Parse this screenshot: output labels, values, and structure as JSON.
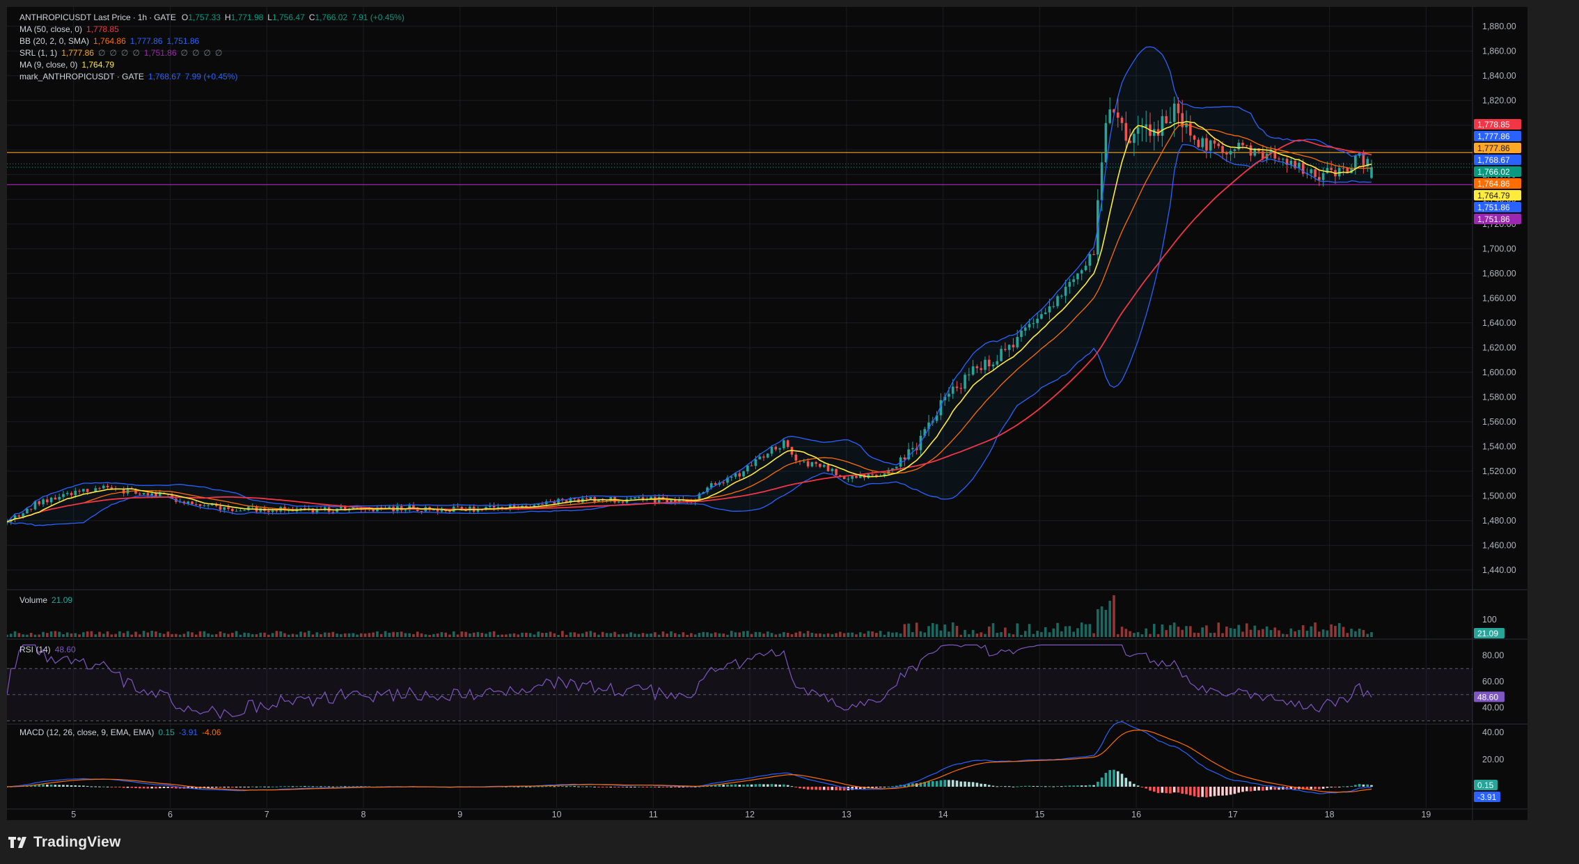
{
  "header": {
    "symbol": "ANTHROPICUSDT",
    "price_type": "Last Price",
    "interval": "1h",
    "exchange": "GATE",
    "sep": "·",
    "o_label": "O",
    "o_value": "1,757.33",
    "h_label": "H",
    "h_value": "1,771.98",
    "l_label": "L",
    "l_value": "1,756.47",
    "c_label": "C",
    "c_value": "1,766.02",
    "change": "7.91 (+0.45%)"
  },
  "indicators": [
    {
      "label": "MA (50, close, 0)",
      "values": [
        "1,778.85"
      ],
      "colors": [
        "#f23645"
      ]
    },
    {
      "label": "BB (20, 2, 0, SMA)",
      "values": [
        "1,764.86",
        "1,777.86",
        "1,751.86"
      ],
      "colors": [
        "#ff6d00",
        "#2962ff",
        "#2962ff"
      ]
    },
    {
      "label": "SRL (1, 1)",
      "values": [
        "1,777.86",
        "∅",
        "∅",
        "∅",
        "∅",
        "1,751.86",
        "∅",
        "∅",
        "∅",
        "∅"
      ],
      "colors": [
        "#ffa726",
        "#787b86",
        "#787b86",
        "#787b86",
        "#787b86",
        "#9c27b0",
        "#787b86",
        "#787b86",
        "#787b86",
        "#787b86"
      ]
    },
    {
      "label": "MA (9, close, 0)",
      "values": [
        "1,764.79"
      ],
      "colors": [
        "#ffeb3b"
      ]
    },
    {
      "label": "mark_ANTHROPICUSDT · GATE",
      "values": [
        "1,768.67",
        "7.99 (+0.45%)"
      ],
      "colors": [
        "#2962ff",
        "#2962ff"
      ]
    }
  ],
  "panes": {
    "volume": {
      "label": "Volume",
      "value": "21.09",
      "axis_label": "100",
      "badge": "21.09"
    },
    "rsi": {
      "label": "RSI (14)",
      "value": "48.60",
      "axis_labels": [
        "80.00",
        "60.00",
        "40.00"
      ],
      "badge": "48.60"
    },
    "macd": {
      "label": "MACD (12, 26, close, 9, EMA, EMA)",
      "values": [
        "0.15",
        "-3.91",
        "-4.06"
      ],
      "axis_labels": [
        "40.00",
        "20.00"
      ],
      "badges": [
        "0.15",
        "-3.91"
      ]
    }
  },
  "price_badges": [
    {
      "text": "1,778.85",
      "color": "#f23645"
    },
    {
      "text": "1,777.86",
      "color": "#2962ff"
    },
    {
      "text": "1,777.86",
      "color": "#ffa726"
    },
    {
      "text": "1,768.67",
      "color": "#2962ff"
    },
    {
      "text": "1,766.02",
      "color": "#089981"
    },
    {
      "text": "1,764.86",
      "color": "#ff6d00"
    },
    {
      "text": "1,764.79",
      "color": "#ffeb3b"
    },
    {
      "text": "1,751.86",
      "color": "#2962ff"
    },
    {
      "text": "1,751.86",
      "color": "#9c27b0"
    }
  ],
  "footer": {
    "brand": "TradingView",
    "logo_icon": "tradingview-logo-icon"
  },
  "colors": {
    "up": "#26a69a",
    "down": "#ef5350",
    "ma50": "#f23645",
    "ma9": "#ffeb3b",
    "bb_basis": "#ff6d00",
    "bb_band": "#2962ff",
    "rsi": "#7e57c2",
    "macd": "#2962ff",
    "signal": "#ff6d00"
  },
  "chart_data": {
    "type": "candlestick",
    "interval": "1h",
    "y_axis_labels": [
      "1,880.00",
      "1,860.00",
      "1,840.00",
      "1,820.00",
      "1,800.00",
      "1,780.00",
      "1,760.00",
      "1,740.00",
      "1,720.00",
      "1,700.00",
      "1,680.00",
      "1,660.00",
      "1,640.00",
      "1,620.00",
      "1,600.00",
      "1,580.00",
      "1,560.00",
      "1,540.00",
      "1,520.00",
      "1,500.00",
      "1,480.00",
      "1,460.00",
      "1,440.00"
    ],
    "ylim": [
      1432,
      1890
    ],
    "x_tick_labels": [
      "5",
      "6",
      "7",
      "8",
      "9",
      "10",
      "11",
      "12",
      "13",
      "14",
      "15",
      "16",
      "17",
      "18",
      "19"
    ],
    "x_range_days": [
      4.31,
      19.48
    ],
    "close_anchors": [
      [
        4.31,
        1478
      ],
      [
        4.6,
        1494
      ],
      [
        4.9,
        1502
      ],
      [
        5.3,
        1506
      ],
      [
        5.8,
        1502
      ],
      [
        6.1,
        1497
      ],
      [
        6.5,
        1490
      ],
      [
        7.0,
        1489
      ],
      [
        7.5,
        1489
      ],
      [
        8.0,
        1490
      ],
      [
        8.5,
        1490
      ],
      [
        9.0,
        1489
      ],
      [
        9.5,
        1490
      ],
      [
        10.0,
        1496
      ],
      [
        10.5,
        1497
      ],
      [
        11.0,
        1497
      ],
      [
        11.4,
        1496
      ],
      [
        11.6,
        1508
      ],
      [
        11.9,
        1518
      ],
      [
        12.2,
        1536
      ],
      [
        12.35,
        1543
      ],
      [
        12.5,
        1528
      ],
      [
        12.8,
        1522
      ],
      [
        13.0,
        1514
      ],
      [
        13.3,
        1516
      ],
      [
        13.5,
        1524
      ],
      [
        13.8,
        1548
      ],
      [
        14.0,
        1578
      ],
      [
        14.3,
        1600
      ],
      [
        14.6,
        1614
      ],
      [
        14.8,
        1630
      ],
      [
        15.0,
        1647
      ],
      [
        15.2,
        1660
      ],
      [
        15.4,
        1680
      ],
      [
        15.58,
        1700
      ],
      [
        15.62,
        1755
      ],
      [
        15.7,
        1815
      ],
      [
        15.85,
        1800
      ],
      [
        16.0,
        1790
      ],
      [
        16.2,
        1800
      ],
      [
        16.35,
        1812
      ],
      [
        16.5,
        1795
      ],
      [
        16.7,
        1784
      ],
      [
        16.9,
        1782
      ],
      [
        17.1,
        1780
      ],
      [
        17.3,
        1778
      ],
      [
        17.5,
        1770
      ],
      [
        17.7,
        1764
      ],
      [
        17.9,
        1760
      ],
      [
        18.2,
        1760
      ],
      [
        18.3,
        1775
      ],
      [
        18.45,
        1766
      ]
    ],
    "last_ohlc": {
      "open": 1757.33,
      "high": 1771.98,
      "low": 1756.47,
      "close": 1766.02,
      "change": 7.91,
      "change_pct": 0.45
    },
    "indicators": {
      "ma50": 1778.85,
      "ma9": 1764.79,
      "bb_basis": 1764.86,
      "bb_upper": 1777.86,
      "bb_lower": 1751.86,
      "srl_upper": 1777.86,
      "srl_lower": 1751.86,
      "mark_price": 1768.67,
      "volume_last": 21.09,
      "volume_axis": [
        100
      ],
      "rsi_last": 48.6,
      "rsi_levels": [
        70,
        50,
        30
      ],
      "rsi_axis": [
        80,
        60,
        40
      ],
      "macd_hist_last": 0.15,
      "macd_last": -3.91,
      "macd_signal_last": -4.06,
      "macd_axis": [
        40,
        20
      ]
    }
  }
}
